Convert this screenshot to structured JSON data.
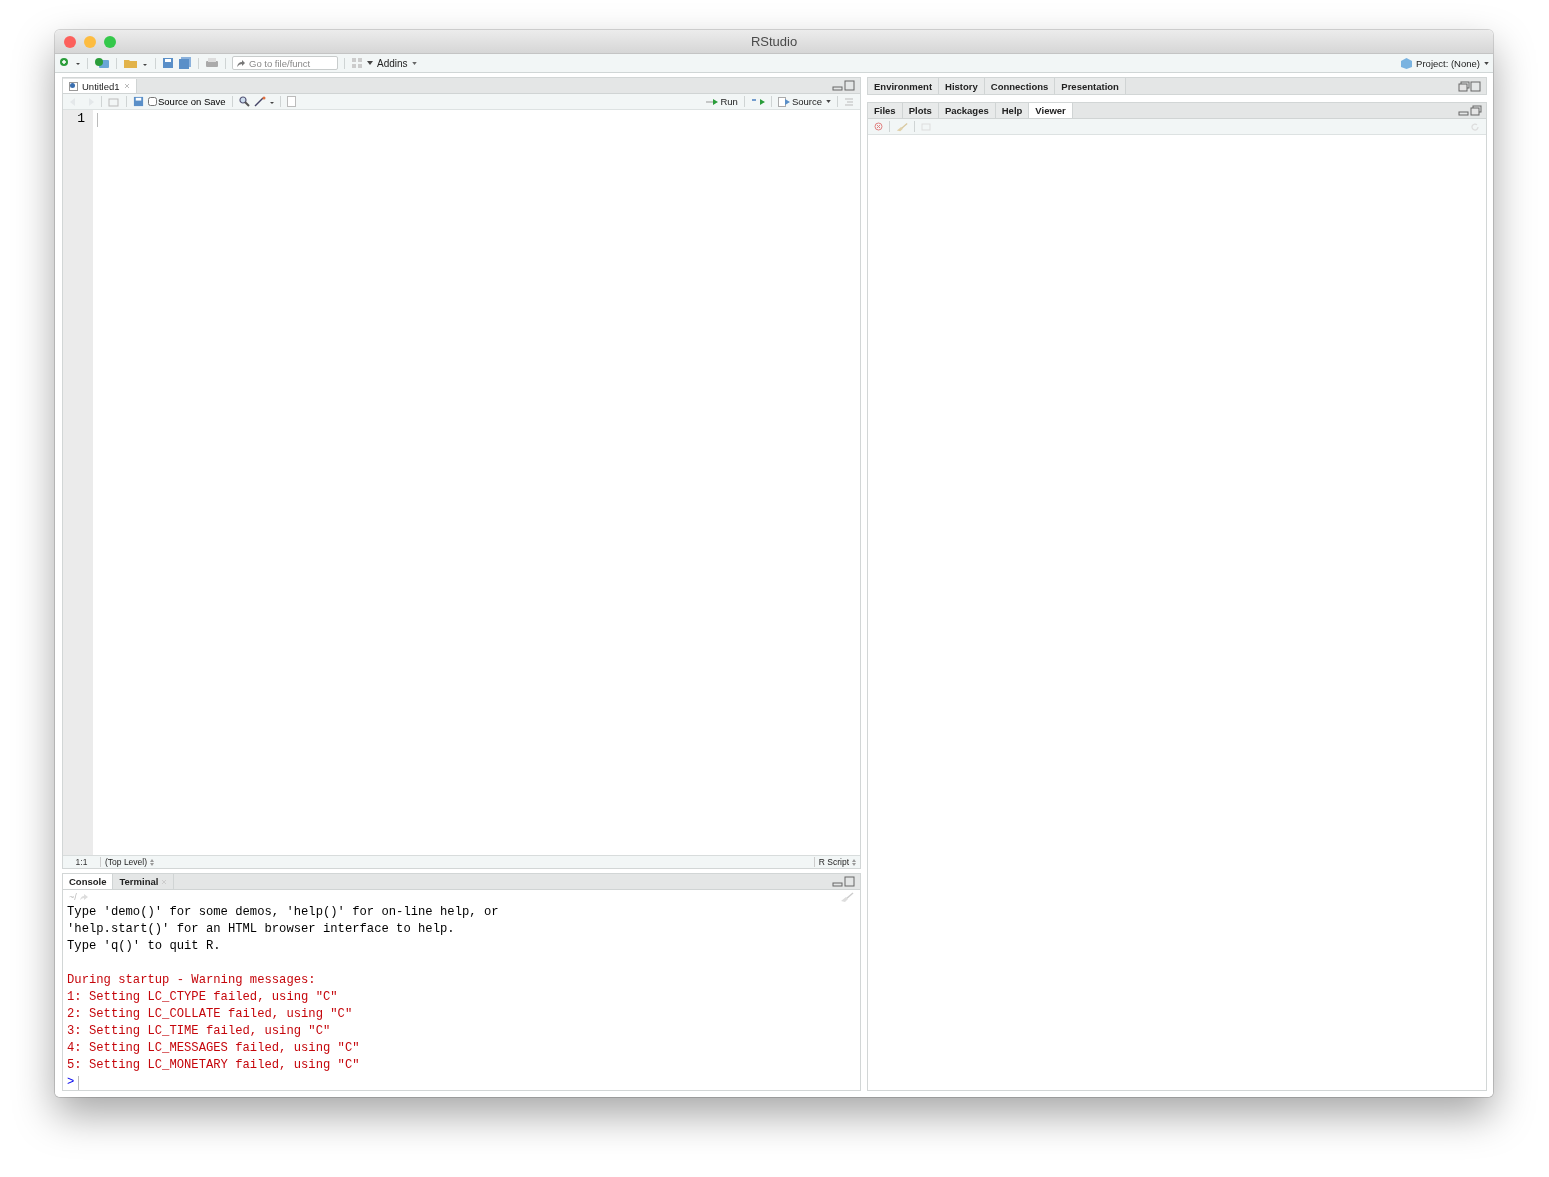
{
  "window": {
    "title": "RStudio"
  },
  "toolbar": {
    "goto_placeholder": "Go to file/funct",
    "addins": "Addins",
    "project": "Project: (None)"
  },
  "editor": {
    "tabs": [
      {
        "label": "Untitled1",
        "selected": true
      }
    ],
    "source_on_save": {
      "label": "Source on Save",
      "checked": false
    },
    "run": "Run",
    "source": "Source",
    "line_numbers": [
      "1"
    ],
    "status": {
      "position": "1:1",
      "scope": "(Top Level)",
      "filetype": "R Script"
    }
  },
  "console": {
    "tabs": [
      {
        "label": "Console",
        "selected": true
      },
      {
        "label": "Terminal",
        "selected": false
      }
    ],
    "path": "~/",
    "lines": [
      {
        "text": "Type 'demo()' for some demos, 'help()' for on-line help, or",
        "kind": "output"
      },
      {
        "text": "'help.start()' for an HTML browser interface to help.",
        "kind": "output"
      },
      {
        "text": "Type 'q()' to quit R.",
        "kind": "output"
      },
      {
        "kind": "blank"
      },
      {
        "text": "During startup - Warning messages:",
        "kind": "warning"
      },
      {
        "text": "1: Setting LC_CTYPE failed, using \"C\"",
        "kind": "warning"
      },
      {
        "text": "2: Setting LC_COLLATE failed, using \"C\"",
        "kind": "warning"
      },
      {
        "text": "3: Setting LC_TIME failed, using \"C\"",
        "kind": "warning"
      },
      {
        "text": "4: Setting LC_MESSAGES failed, using \"C\"",
        "kind": "warning"
      },
      {
        "text": "5: Setting LC_MONETARY failed, using \"C\"",
        "kind": "warning"
      }
    ],
    "prompt": ">"
  },
  "right_top": {
    "tabs": [
      {
        "label": "Environment",
        "selected": false
      },
      {
        "label": "History",
        "selected": false
      },
      {
        "label": "Connections",
        "selected": false
      },
      {
        "label": "Presentation",
        "selected": false
      }
    ]
  },
  "right_bottom": {
    "tabs": [
      {
        "label": "Files",
        "selected": false
      },
      {
        "label": "Plots",
        "selected": false
      },
      {
        "label": "Packages",
        "selected": false
      },
      {
        "label": "Help",
        "selected": false
      },
      {
        "label": "Viewer",
        "selected": true
      }
    ]
  }
}
